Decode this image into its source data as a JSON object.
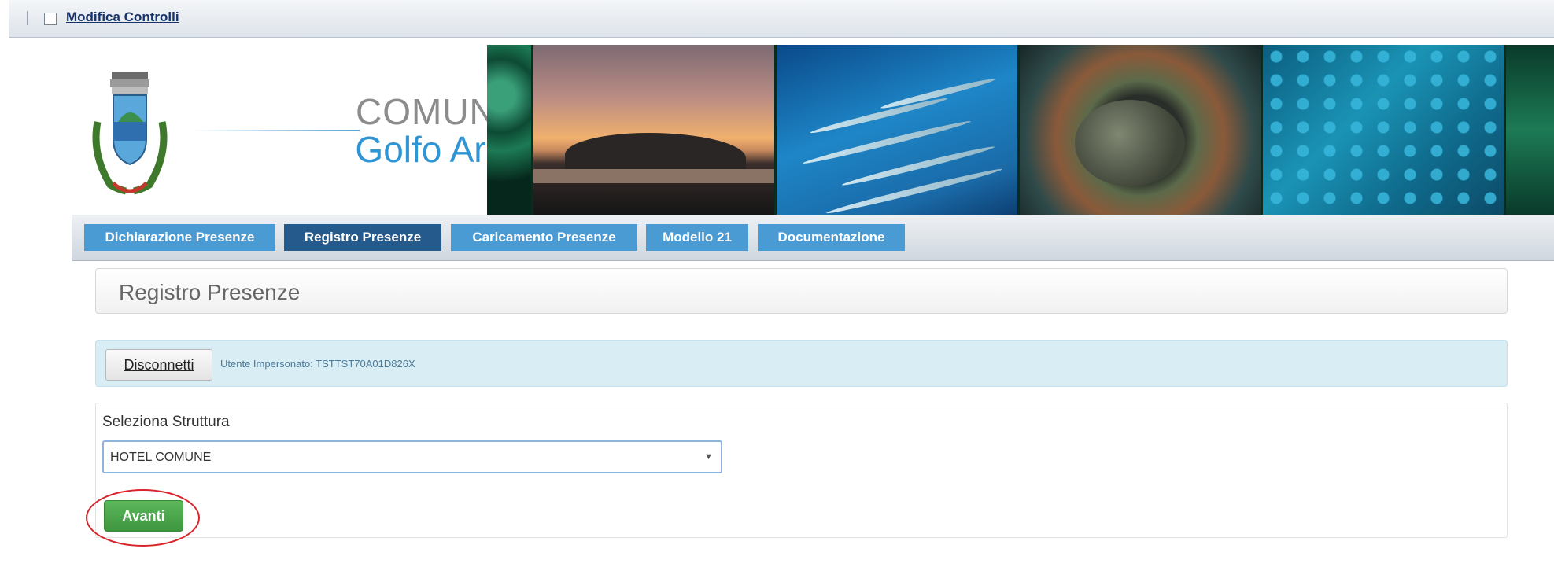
{
  "topbar": {
    "title": "Modifica Controlli"
  },
  "header": {
    "logo_line1": "COMUNE di",
    "logo_line2": "Golfo Aranci"
  },
  "nav": {
    "tabs": [
      {
        "label": "Dichiarazione Presenze",
        "active": false
      },
      {
        "label": "Registro Presenze",
        "active": true
      },
      {
        "label": "Caricamento Presenze",
        "active": false
      },
      {
        "label": "Modello 21",
        "active": false
      },
      {
        "label": "Documentazione",
        "active": false
      }
    ]
  },
  "main": {
    "page_title": "Registro Presenze",
    "alert": {
      "disconnect_label": "Disconnetti",
      "impersonated_text": "Utente Impersonato: TSTTST70A01D826X"
    },
    "form": {
      "select_label": "Seleziona Struttura",
      "select_value": "HOTEL COMUNE",
      "submit_label": "Avanti"
    }
  },
  "colors": {
    "tab_blue": "#4a9ad4",
    "tab_active": "#245a8c",
    "logo_blue": "#2f95d3",
    "success_green": "#5cb85c",
    "highlight_red": "#d9232a"
  }
}
